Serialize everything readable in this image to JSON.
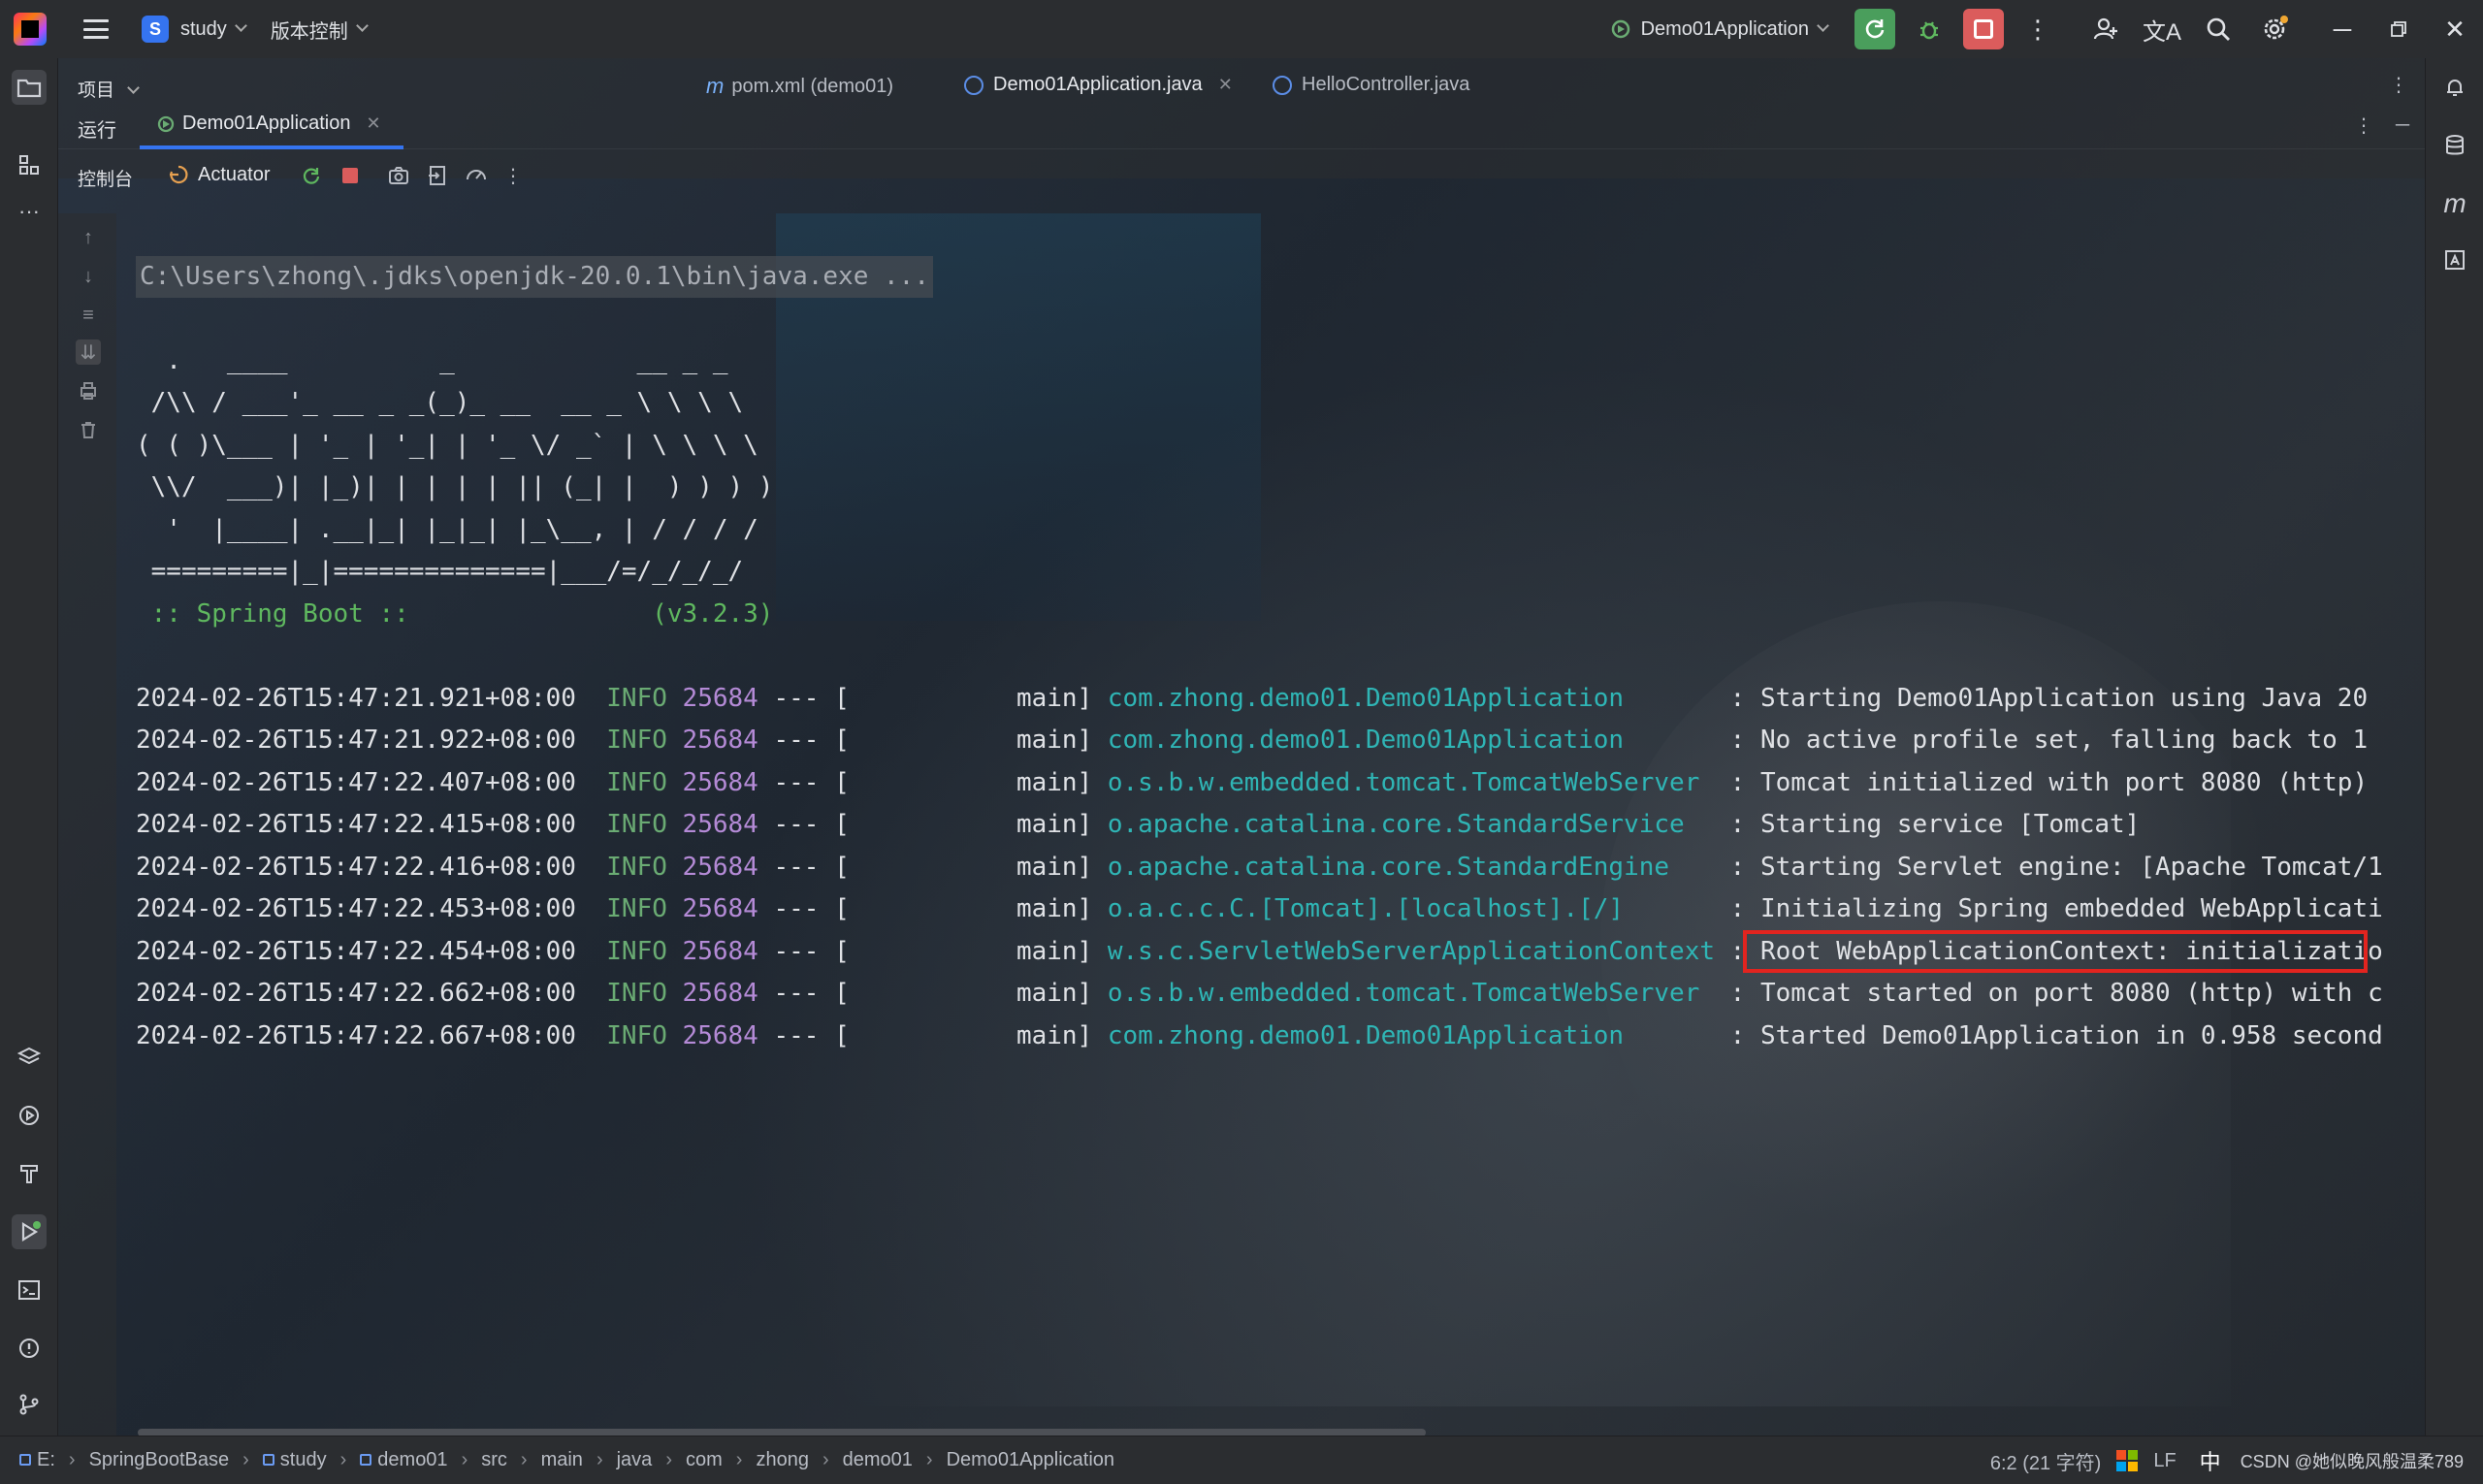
{
  "titlebar": {
    "project_badge": "S",
    "project_name": "study",
    "vcs_menu": "版本控制",
    "run_config": "Demo01Application"
  },
  "editor_tabs": {
    "project_label": "项目",
    "tabs": [
      {
        "label": "pom.xml (demo01)",
        "icon": "m"
      },
      {
        "label": "Demo01Application.java"
      },
      {
        "label": "HelloController.java"
      }
    ]
  },
  "run_panel": {
    "label": "运行",
    "active_tab": "Demo01Application",
    "console_label": "控制台",
    "actuator_label": "Actuator"
  },
  "console": {
    "command": "C:\\Users\\zhong\\.jdks\\openjdk-20.0.1\\bin\\java.exe ...",
    "banner": [
      "  .   ____          _            __ _ _",
      " /\\\\ / ___'_ __ _ _(_)_ __  __ _ \\ \\ \\ \\",
      "( ( )\\___ | '_ | '_| | '_ \\/ _` | \\ \\ \\ \\",
      " \\\\/  ___)| |_)| | | | | || (_| |  ) ) ) )",
      "  '  |____| .__|_| |_|_| |_\\__, | / / / /",
      " =========|_|==============|___/=/_/_/_/"
    ],
    "spring_label": " :: Spring Boot ::                (v3.2.3)",
    "logs": [
      {
        "ts": "2024-02-26T15:47:21.921+08:00",
        "level": "INFO",
        "pid": "25684",
        "thread": "--- [           main]",
        "logger": "com.zhong.demo01.Demo01Application      ",
        "msg": " : Starting Demo01Application using Java 20"
      },
      {
        "ts": "2024-02-26T15:47:21.922+08:00",
        "level": "INFO",
        "pid": "25684",
        "thread": "--- [           main]",
        "logger": "com.zhong.demo01.Demo01Application      ",
        "msg": " : No active profile set, falling back to 1"
      },
      {
        "ts": "2024-02-26T15:47:22.407+08:00",
        "level": "INFO",
        "pid": "25684",
        "thread": "--- [           main]",
        "logger": "o.s.b.w.embedded.tomcat.TomcatWebServer ",
        "msg": " : Tomcat initialized with port 8080 (http)"
      },
      {
        "ts": "2024-02-26T15:47:22.415+08:00",
        "level": "INFO",
        "pid": "25684",
        "thread": "--- [           main]",
        "logger": "o.apache.catalina.core.StandardService  ",
        "msg": " : Starting service [Tomcat]"
      },
      {
        "ts": "2024-02-26T15:47:22.416+08:00",
        "level": "INFO",
        "pid": "25684",
        "thread": "--- [           main]",
        "logger": "o.apache.catalina.core.StandardEngine   ",
        "msg": " : Starting Servlet engine: [Apache Tomcat/1"
      },
      {
        "ts": "2024-02-26T15:47:22.453+08:00",
        "level": "INFO",
        "pid": "25684",
        "thread": "--- [           main]",
        "logger": "o.a.c.c.C.[Tomcat].[localhost].[/]      ",
        "msg": " : Initializing Spring embedded WebApplicati"
      },
      {
        "ts": "2024-02-26T15:47:22.454+08:00",
        "level": "INFO",
        "pid": "25684",
        "thread": "--- [           main]",
        "logger": "w.s.c.ServletWebServerApplicationContext",
        "msg": " : Root WebApplicationContext: initializatio"
      },
      {
        "ts": "2024-02-26T15:47:22.662+08:00",
        "level": "INFO",
        "pid": "25684",
        "thread": "--- [           main]",
        "logger": "o.s.b.w.embedded.tomcat.TomcatWebServer ",
        "msg": " : Tomcat started on port 8080 (http) with c"
      },
      {
        "ts": "2024-02-26T15:47:22.667+08:00",
        "level": "INFO",
        "pid": "25684",
        "thread": "--- [           main]",
        "logger": "com.zhong.demo01.Demo01Application      ",
        "msg": " : Started Demo01Application in 0.958 second"
      }
    ]
  },
  "statusbar": {
    "breadcrumbs": [
      "E:",
      "SpringBootBase",
      "study",
      "demo01",
      "src",
      "main",
      "java",
      "com",
      "zhong",
      "demo01",
      "Demo01Application"
    ],
    "cursor": "6:2 (21 字符)",
    "encoding": "LF",
    "ime": "中",
    "watermark": "CSDN @她似晚风般温柔789"
  },
  "colors": {
    "accent": "#3574f0",
    "run_green": "#4a9e5c",
    "stop_red": "#db5c5c",
    "highlight_box": "#e2241f",
    "logger_cyan": "#2fb5b5",
    "level_green": "#6aab73",
    "pid_purple": "#b48ad6"
  }
}
